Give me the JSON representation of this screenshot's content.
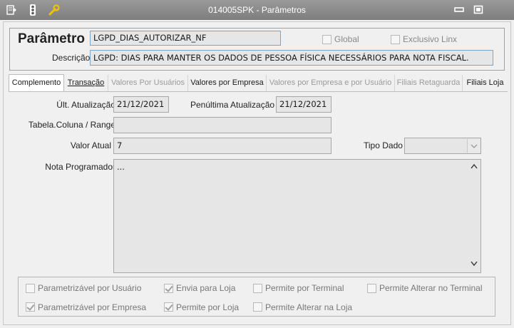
{
  "window": {
    "title": "014005SPK - Parâmetros"
  },
  "header": {
    "param_label": "Parâmetro",
    "param_value": "LGPD_DIAS_AUTORIZAR_NF",
    "global_label": "Global",
    "exclusivo_label": "Exclusivo Linx",
    "descricao_label": "Descrição",
    "descricao_value": "LGPD: DIAS PARA MANTER OS DADOS DE PESSOA FÍSICA NECESSÁRIOS PARA NOTA FISCAL."
  },
  "tabs": [
    {
      "label": "Complemento",
      "state": "active"
    },
    {
      "label": "Transação",
      "state": "enabled"
    },
    {
      "label": "Valores Por Usuários",
      "state": "disabled"
    },
    {
      "label": "Valores por Empresa",
      "state": "enabled"
    },
    {
      "label": "Valores por Empresa e por Usuário",
      "state": "disabled"
    },
    {
      "label": "Filiais Retaguarda",
      "state": "disabled"
    },
    {
      "label": "Filiais Loja",
      "state": "enabled"
    }
  ],
  "complemento": {
    "ult_atualizacao_label": "Últ. Atualização",
    "ult_atualizacao_value": "21/12/2021",
    "penultima_label": "Penúltima Atualização",
    "penultima_value": "21/12/2021",
    "tabela_label": "Tabela.Coluna / Range",
    "tabela_value": "",
    "valor_atual_label": "Valor Atual",
    "valor_atual_value": "7",
    "tipo_dado_label": "Tipo Dado",
    "tipo_dado_value": "",
    "nota_label": "Nota Programador",
    "nota_value": "..."
  },
  "options": [
    {
      "label": "Parametrizável por Usuário",
      "checked": false
    },
    {
      "label": "Envia para Loja",
      "checked": true
    },
    {
      "label": "Permite por Terminal",
      "checked": false
    },
    {
      "label": "Permite Alterar no Terminal",
      "checked": false
    },
    {
      "label": "Parametrizável por Empresa",
      "checked": true
    },
    {
      "label": "Permite por Loja",
      "checked": true
    },
    {
      "label": "Permite Alterar na Loja",
      "checked": false
    }
  ]
}
